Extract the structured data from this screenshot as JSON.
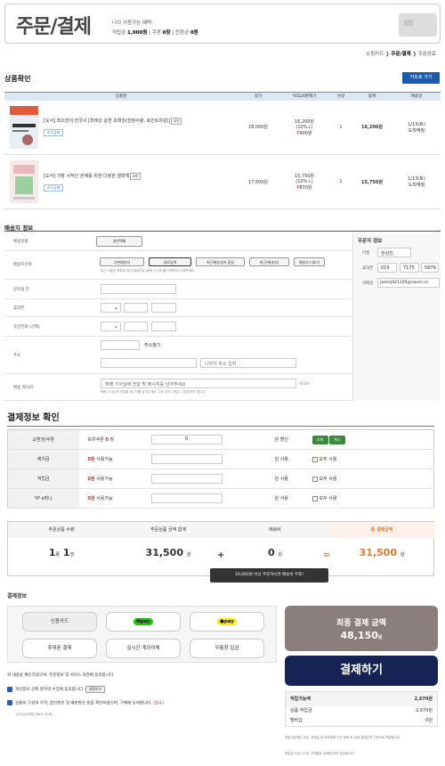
{
  "header": {
    "title": "주문/결제",
    "benefit_title": "나의 사용가능 혜택:",
    "pt_label": "적립금",
    "pt_val": "1,000원",
    "cp_label": "쿠폰",
    "cp_val": "0장",
    "gift_label": "전환금",
    "gift_val": "0원"
  },
  "breadcrumb": {
    "step1": "쇼핑카트",
    "step2": "주문/결제",
    "step3": "주문완료"
  },
  "products": {
    "section_title": "상품확인",
    "cart_button": "카트로 가기",
    "columns": [
      "상품명",
      "정가",
      "YES24판매가",
      "수량",
      "합계",
      "배송일"
    ],
    "items": [
      {
        "name": "[도서] 최소한의 한국사 [최태성 강연 초대권(한정수량, 포인트차감)]",
        "tag": "새창",
        "flag": "소득공제",
        "list_price": "18,000원",
        "sale_price": "16,200원",
        "discount": "(10%↓)",
        "point": "900원",
        "qty": "1",
        "total": "16,200원",
        "ship1": "1/13(토)",
        "ship2": "도착예정",
        "cover_text": "최소한의 한국사"
      },
      {
        "name": "[도서] 가장 사적인 관계를 위한 다정한 철학책",
        "tag": "새창",
        "flag": "소득공제",
        "list_price": "17,500원",
        "sale_price": "15,750원",
        "discount": "(10%↓)",
        "point": "870원",
        "qty": "1",
        "total": "15,750원",
        "ship1": "1/13(토)",
        "ship2": "도착예정",
        "cover_text": ""
      }
    ]
  },
  "shipping": {
    "section_title": "배송지 정보",
    "method_label": "배송방법",
    "method_value": "일반택배",
    "select_label": "배송지선택",
    "opt1": "기본배송지",
    "opt2": "새로입력",
    "opt3": "최근배송지와 동일",
    "opt4": "최근(배송지)",
    "opt5": "배송지 더보기",
    "select_note": "최근 사용된 목록에 최대 배송지로 [배송지 관리]를 선택하여 입력하세요.",
    "recv_label": "받으실 분",
    "home_label": "휴대폰",
    "tel_label": "유선전화 (선택)",
    "addr_label": "주소",
    "addr_button": "주소찾기",
    "addr_placeholder": "나머지 주소 입력",
    "msg_label": "배송 메시지",
    "msg_placeholder": "택배 기사님께 전달 할 메시지를 남겨주세요",
    "msg_count": "(0/30)",
    "msg_note": "택배 기사님께 전달할 메시지를 남겨주세요. 주소 입력 사항은 기입하셔야 합니다."
  },
  "orderer": {
    "title": "주문자 정보",
    "name_label": "이름",
    "name_value": "전성진",
    "phone_label": "휴대폰",
    "phone1": "010",
    "phone2": "7175",
    "phone3": "5879",
    "email_label": "이메일",
    "email_value": "jeonsj921105@naver.co"
  },
  "payinfo": {
    "title": "결제정보 확인",
    "coupon_label": "교환권/쿠폰",
    "coupon_text": "보유쿠폰",
    "coupon_count": "0",
    "coupon_unit": "장",
    "coupon_value": "0",
    "coupon_unit2": "원 할인",
    "inquiry_btn": "조회",
    "cancel_btn": "취소",
    "deposit_label": "예치금",
    "points_label": "적립금",
    "ypay_label": "YP e머니",
    "zero_amount": "0원",
    "avail_text": "사용가능",
    "use_text": "원 사용",
    "all_use": "모두 사용"
  },
  "summary": {
    "h1": "주문상품 수량",
    "h2": "주문상품 금액 합계",
    "h3": "배송비",
    "h4": "총 결제금액",
    "kinds": "1",
    "kinds_unit": "종",
    "count": "1",
    "count_unit": "권",
    "amount": "31,500",
    "amount_unit": "원",
    "ship": "0",
    "ship_unit": "원",
    "total": "31,500",
    "total_unit": "원",
    "plus": "+",
    "equals": "=",
    "tip": "10,000원 이상 주문하시면 배송비 무료!"
  },
  "payment": {
    "title": "결제정보",
    "credit_card": "신용카드",
    "naverpay": "pay",
    "kakaopay": "pay",
    "phone_pay": "휴대폰 결제",
    "realtime": "실시간 계좌이체",
    "deposit": "무통장 입금",
    "notice": "위 내용을 확인하였으며, 주문정보 및 서비스 약관에 동의합니다.",
    "agree1": "개인정보 선택 항목의 수집에 동의합니다.",
    "agree1_btn": "내용보기",
    "agree2": "상품의 구성과 가격, 할인정보 및 배송정보 등을 확인하였으며, 구매에 동의합니다.",
    "agree2_req": "(필수)",
    "agree2_sub": "(전자상거래법 제8조 제2항)",
    "final_label": "최종 결제 금액",
    "final_amount": "48,150",
    "final_unit": "원",
    "pay_button": "결제하기",
    "points_total_label": "적립가능액",
    "points_total": "2,670원",
    "pts_item1": "상품 적립금",
    "pts_item1_val": "2,670원",
    "pts_item2": "멤버십",
    "pts_item2_val": "0원",
    "note1": "적립가능액은 쿠폰, 적립금 등 보조결제 수단 제외 후 실제 결제금액 기준으로 적립됩니다.",
    "note2": "적립금 지급 시기는 구매완료 상태에 따라 지급됩니다."
  },
  "colors": {
    "accent": "#1a5bb0",
    "pay_navy": "#162355",
    "final_bg": "#8b7f7d",
    "total_orange": "#e4782a",
    "green": "#3a8b3a"
  }
}
